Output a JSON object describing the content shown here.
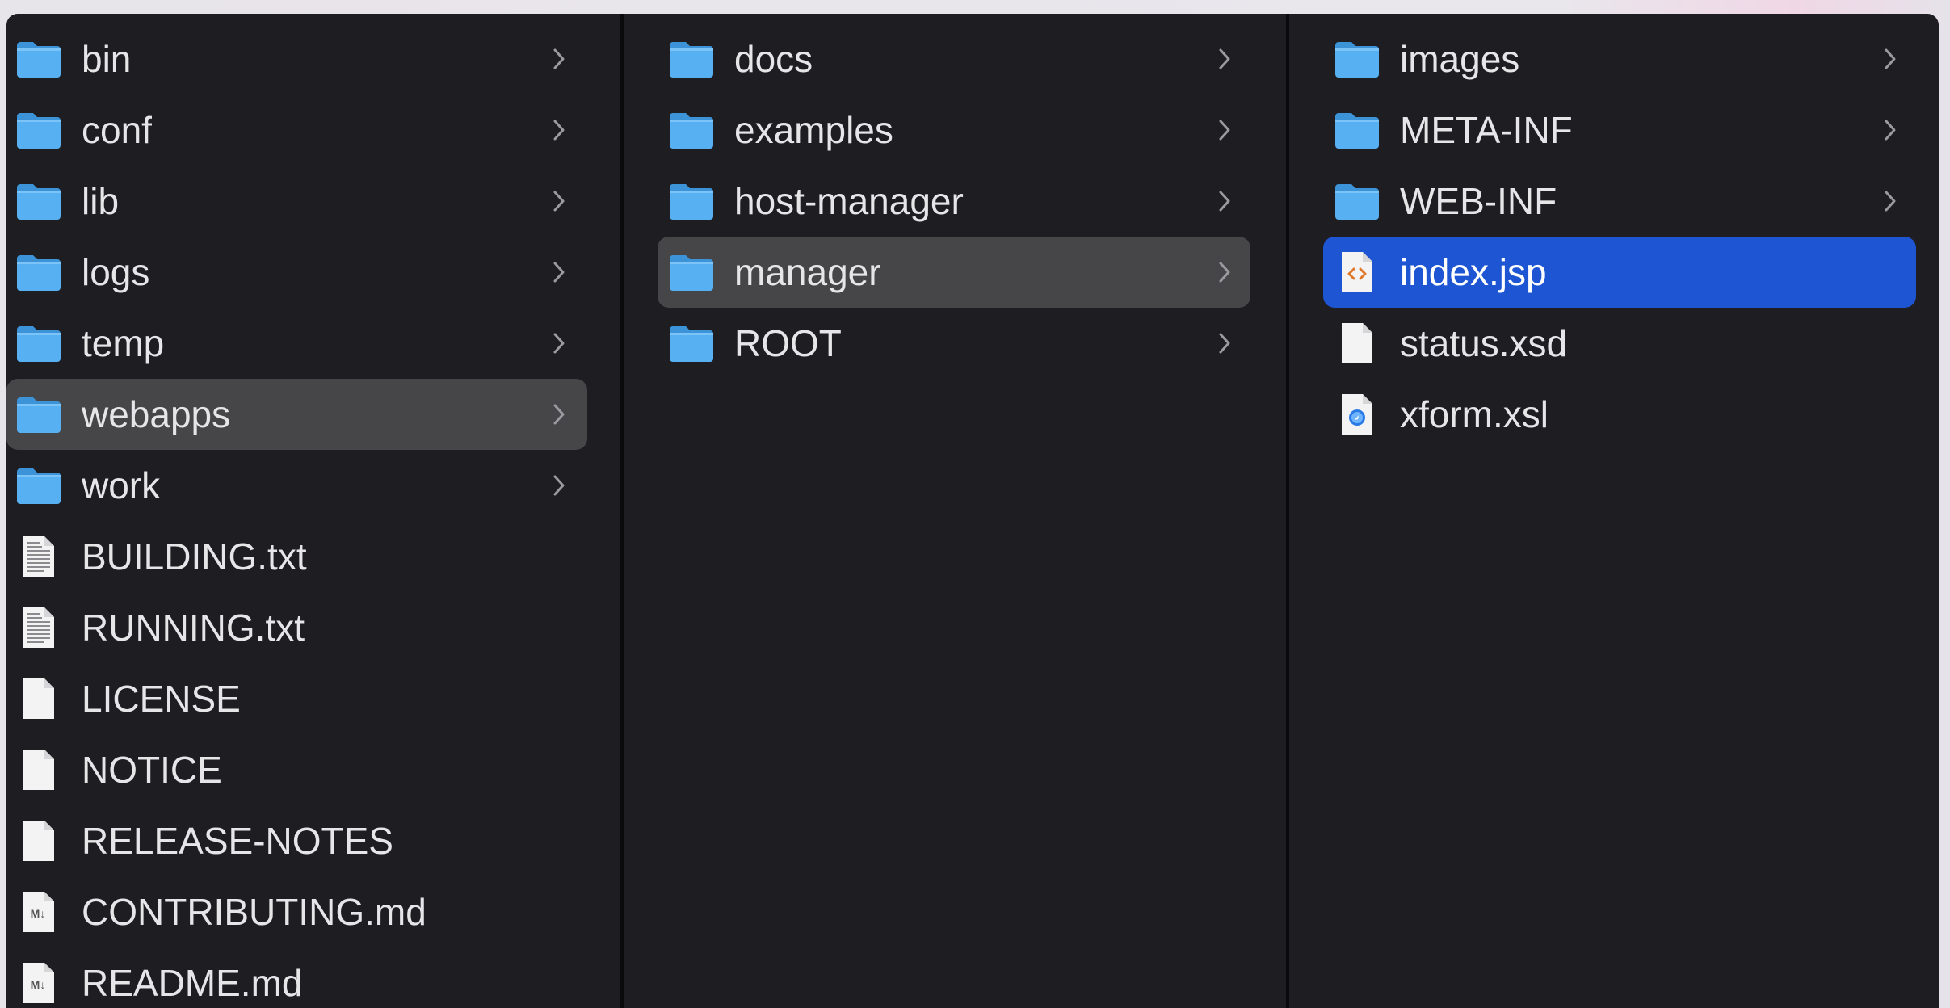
{
  "columns": [
    {
      "items": [
        {
          "name": "bin",
          "kind": "folder",
          "chevron": true
        },
        {
          "name": "conf",
          "kind": "folder",
          "chevron": true
        },
        {
          "name": "lib",
          "kind": "folder",
          "chevron": true
        },
        {
          "name": "logs",
          "kind": "folder",
          "chevron": true
        },
        {
          "name": "temp",
          "kind": "folder",
          "chevron": true
        },
        {
          "name": "webapps",
          "kind": "folder",
          "chevron": true,
          "selected": "path"
        },
        {
          "name": "work",
          "kind": "folder",
          "chevron": true
        },
        {
          "name": "BUILDING.txt",
          "kind": "text-file"
        },
        {
          "name": "RUNNING.txt",
          "kind": "text-file"
        },
        {
          "name": "LICENSE",
          "kind": "blank-file"
        },
        {
          "name": "NOTICE",
          "kind": "blank-file"
        },
        {
          "name": "RELEASE-NOTES",
          "kind": "blank-file"
        },
        {
          "name": "CONTRIBUTING.md",
          "kind": "markdown-file"
        },
        {
          "name": "README.md",
          "kind": "markdown-file"
        }
      ]
    },
    {
      "items": [
        {
          "name": "docs",
          "kind": "folder",
          "chevron": true
        },
        {
          "name": "examples",
          "kind": "folder",
          "chevron": true
        },
        {
          "name": "host-manager",
          "kind": "folder",
          "chevron": true
        },
        {
          "name": "manager",
          "kind": "folder",
          "chevron": true,
          "selected": "path"
        },
        {
          "name": "ROOT",
          "kind": "folder",
          "chevron": true
        }
      ]
    },
    {
      "items": [
        {
          "name": "images",
          "kind": "folder",
          "chevron": true
        },
        {
          "name": "META-INF",
          "kind": "folder",
          "chevron": true
        },
        {
          "name": "WEB-INF",
          "kind": "folder",
          "chevron": true
        },
        {
          "name": "index.jsp",
          "kind": "code-file",
          "selected": "active"
        },
        {
          "name": "status.xsd",
          "kind": "blank-file"
        },
        {
          "name": "xform.xsl",
          "kind": "xsl-file"
        }
      ]
    }
  ],
  "colors": {
    "window_bg": "#1e1e22",
    "path_selection": "#464649",
    "active_selection": "#1d55d3",
    "folder_blue": "#4ea9ee",
    "text": "#e6e6e8"
  }
}
